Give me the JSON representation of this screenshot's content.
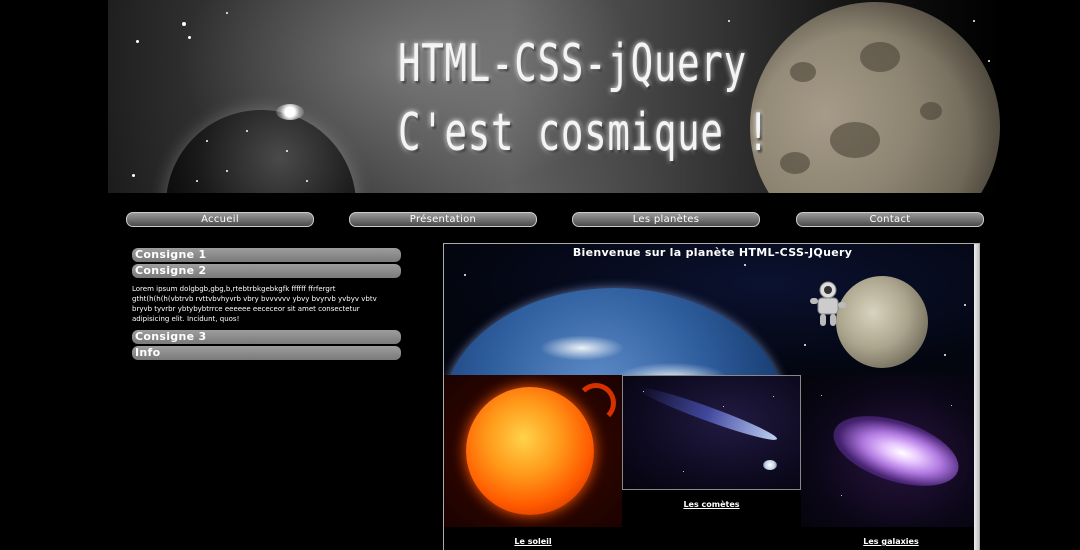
{
  "banner": {
    "title_line1": "HTML-CSS-jQuery",
    "title_line2": "C'est cosmique !"
  },
  "nav": {
    "items": [
      {
        "label": "Accueil"
      },
      {
        "label": "Présentation"
      },
      {
        "label": "Les planètes"
      },
      {
        "label": "Contact"
      }
    ]
  },
  "accordion": {
    "sections": [
      {
        "title": "Consigne 1",
        "body": ""
      },
      {
        "title": "Consigne 2",
        "body": "Lorem ipsum dolgbgb,gbg,b,rtebtrbkgebkgfk ffffff ffrfergrt gtht(h(h(h(vbtrvb rvttvbvhyvrb vbry bvvvvvv ybvy bvyrvb yvbyv vbtv bryvb tyvrbr ybtybybtrrce eeeeee eececeor sit amet consectetur adipisicing elit. Incidunt, quos!"
      },
      {
        "title": "Consigne 3",
        "body": ""
      },
      {
        "title": "Info",
        "body": ""
      }
    ]
  },
  "main": {
    "welcome": "Bienvenue sur la planète HTML-CSS-JQuery",
    "tiles": {
      "sun_caption": "Le soleil",
      "comet_caption": "Les comètes",
      "galaxy_caption": "Les galaxies"
    }
  },
  "colors": {
    "background": "#000000",
    "nav_button": "#6f6f6f",
    "accordion_header": "#8a8a8a",
    "text": "#ffffff"
  }
}
